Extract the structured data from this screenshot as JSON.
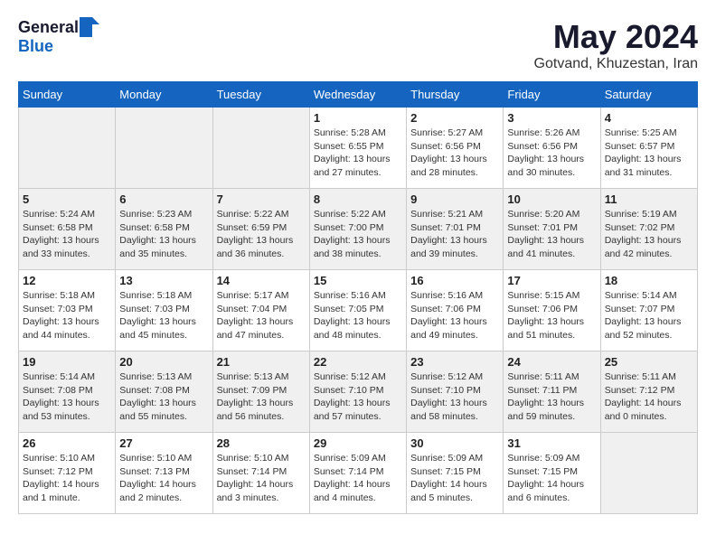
{
  "logo": {
    "general": "General",
    "blue": "Blue"
  },
  "title": "May 2024",
  "location": "Gotvand, Khuzestan, Iran",
  "weekdays": [
    "Sunday",
    "Monday",
    "Tuesday",
    "Wednesday",
    "Thursday",
    "Friday",
    "Saturday"
  ],
  "weeks": [
    [
      {
        "day": "",
        "info": ""
      },
      {
        "day": "",
        "info": ""
      },
      {
        "day": "",
        "info": ""
      },
      {
        "day": "1",
        "info": "Sunrise: 5:28 AM\nSunset: 6:55 PM\nDaylight: 13 hours and 27 minutes."
      },
      {
        "day": "2",
        "info": "Sunrise: 5:27 AM\nSunset: 6:56 PM\nDaylight: 13 hours and 28 minutes."
      },
      {
        "day": "3",
        "info": "Sunrise: 5:26 AM\nSunset: 6:56 PM\nDaylight: 13 hours and 30 minutes."
      },
      {
        "day": "4",
        "info": "Sunrise: 5:25 AM\nSunset: 6:57 PM\nDaylight: 13 hours and 31 minutes."
      }
    ],
    [
      {
        "day": "5",
        "info": "Sunrise: 5:24 AM\nSunset: 6:58 PM\nDaylight: 13 hours and 33 minutes."
      },
      {
        "day": "6",
        "info": "Sunrise: 5:23 AM\nSunset: 6:58 PM\nDaylight: 13 hours and 35 minutes."
      },
      {
        "day": "7",
        "info": "Sunrise: 5:22 AM\nSunset: 6:59 PM\nDaylight: 13 hours and 36 minutes."
      },
      {
        "day": "8",
        "info": "Sunrise: 5:22 AM\nSunset: 7:00 PM\nDaylight: 13 hours and 38 minutes."
      },
      {
        "day": "9",
        "info": "Sunrise: 5:21 AM\nSunset: 7:01 PM\nDaylight: 13 hours and 39 minutes."
      },
      {
        "day": "10",
        "info": "Sunrise: 5:20 AM\nSunset: 7:01 PM\nDaylight: 13 hours and 41 minutes."
      },
      {
        "day": "11",
        "info": "Sunrise: 5:19 AM\nSunset: 7:02 PM\nDaylight: 13 hours and 42 minutes."
      }
    ],
    [
      {
        "day": "12",
        "info": "Sunrise: 5:18 AM\nSunset: 7:03 PM\nDaylight: 13 hours and 44 minutes."
      },
      {
        "day": "13",
        "info": "Sunrise: 5:18 AM\nSunset: 7:03 PM\nDaylight: 13 hours and 45 minutes."
      },
      {
        "day": "14",
        "info": "Sunrise: 5:17 AM\nSunset: 7:04 PM\nDaylight: 13 hours and 47 minutes."
      },
      {
        "day": "15",
        "info": "Sunrise: 5:16 AM\nSunset: 7:05 PM\nDaylight: 13 hours and 48 minutes."
      },
      {
        "day": "16",
        "info": "Sunrise: 5:16 AM\nSunset: 7:06 PM\nDaylight: 13 hours and 49 minutes."
      },
      {
        "day": "17",
        "info": "Sunrise: 5:15 AM\nSunset: 7:06 PM\nDaylight: 13 hours and 51 minutes."
      },
      {
        "day": "18",
        "info": "Sunrise: 5:14 AM\nSunset: 7:07 PM\nDaylight: 13 hours and 52 minutes."
      }
    ],
    [
      {
        "day": "19",
        "info": "Sunrise: 5:14 AM\nSunset: 7:08 PM\nDaylight: 13 hours and 53 minutes."
      },
      {
        "day": "20",
        "info": "Sunrise: 5:13 AM\nSunset: 7:08 PM\nDaylight: 13 hours and 55 minutes."
      },
      {
        "day": "21",
        "info": "Sunrise: 5:13 AM\nSunset: 7:09 PM\nDaylight: 13 hours and 56 minutes."
      },
      {
        "day": "22",
        "info": "Sunrise: 5:12 AM\nSunset: 7:10 PM\nDaylight: 13 hours and 57 minutes."
      },
      {
        "day": "23",
        "info": "Sunrise: 5:12 AM\nSunset: 7:10 PM\nDaylight: 13 hours and 58 minutes."
      },
      {
        "day": "24",
        "info": "Sunrise: 5:11 AM\nSunset: 7:11 PM\nDaylight: 13 hours and 59 minutes."
      },
      {
        "day": "25",
        "info": "Sunrise: 5:11 AM\nSunset: 7:12 PM\nDaylight: 14 hours and 0 minutes."
      }
    ],
    [
      {
        "day": "26",
        "info": "Sunrise: 5:10 AM\nSunset: 7:12 PM\nDaylight: 14 hours and 1 minute."
      },
      {
        "day": "27",
        "info": "Sunrise: 5:10 AM\nSunset: 7:13 PM\nDaylight: 14 hours and 2 minutes."
      },
      {
        "day": "28",
        "info": "Sunrise: 5:10 AM\nSunset: 7:14 PM\nDaylight: 14 hours and 3 minutes."
      },
      {
        "day": "29",
        "info": "Sunrise: 5:09 AM\nSunset: 7:14 PM\nDaylight: 14 hours and 4 minutes."
      },
      {
        "day": "30",
        "info": "Sunrise: 5:09 AM\nSunset: 7:15 PM\nDaylight: 14 hours and 5 minutes."
      },
      {
        "day": "31",
        "info": "Sunrise: 5:09 AM\nSunset: 7:15 PM\nDaylight: 14 hours and 6 minutes."
      },
      {
        "day": "",
        "info": ""
      }
    ]
  ]
}
